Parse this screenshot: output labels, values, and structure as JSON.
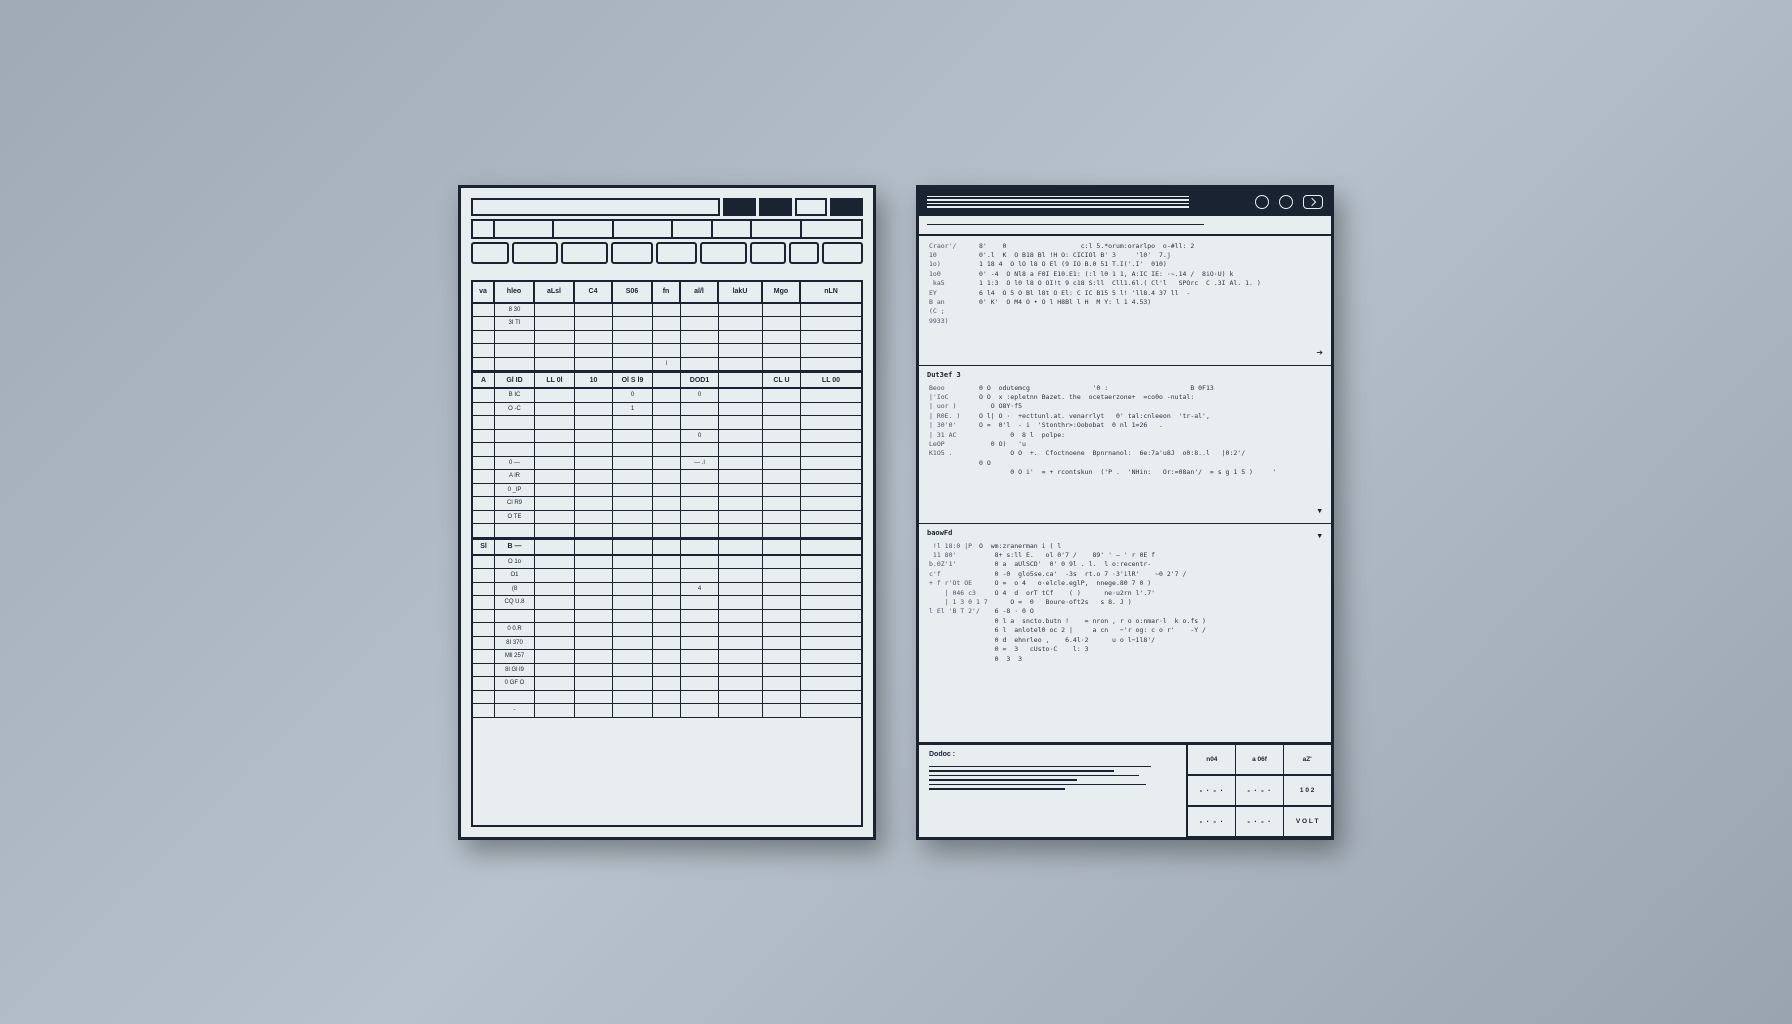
{
  "left": {
    "toolbar_row2_widths": [
      22,
      60,
      60,
      60,
      40,
      40,
      50,
      60
    ],
    "toolbar_row3_widths": [
      40,
      50,
      50,
      44,
      44,
      50,
      38,
      32,
      44
    ],
    "headers1": [
      "va",
      "hleo",
      "aLsl",
      "C4",
      "S06",
      "fn",
      "al/l",
      "lakU",
      "Mgo",
      "nLN"
    ],
    "rows1": [
      [
        "",
        "8 30",
        "",
        "",
        "",
        "",
        "",
        "",
        "",
        ""
      ],
      [
        "",
        "3I TI",
        "",
        "",
        "",
        "",
        "",
        "",
        "",
        ""
      ],
      [
        "",
        "",
        "",
        "",
        "",
        "",
        "",
        "",
        "",
        ""
      ],
      [
        "",
        "",
        "",
        "",
        "",
        "",
        "",
        "",
        "",
        ""
      ],
      [
        "",
        "",
        "",
        "",
        "",
        "l",
        "",
        "",
        "",
        ""
      ]
    ],
    "headers2": [
      "A",
      "Gl ID",
      "LL 0l",
      "10",
      "Ol S l9",
      "",
      "DOD1",
      "",
      "CL U",
      "LL 00"
    ],
    "rows2": [
      [
        "",
        "B IC",
        "",
        "",
        "0",
        "",
        "0",
        "",
        "",
        ""
      ],
      [
        "",
        "O -C",
        "",
        "",
        "1",
        "",
        "",
        "",
        "",
        ""
      ],
      [
        "",
        "",
        "",
        "",
        "",
        "",
        "",
        "",
        "",
        ""
      ],
      [
        "",
        "",
        "",
        "",
        "",
        "",
        "0",
        "",
        "",
        ""
      ],
      [
        "",
        "",
        "",
        "",
        "",
        "",
        "",
        "",
        "",
        ""
      ],
      [
        "",
        "0 —",
        "",
        "",
        "",
        "",
        "— .l",
        "",
        "",
        ""
      ],
      [
        "",
        "A lR",
        "",
        "",
        "",
        "",
        "",
        "",
        "",
        ""
      ],
      [
        "",
        "0 _lP",
        "",
        "",
        "",
        "",
        "",
        "",
        "",
        ""
      ],
      [
        "",
        "Cl R9",
        "",
        "",
        "",
        "",
        "",
        "",
        "",
        ""
      ],
      [
        "",
        "O TE",
        "",
        "",
        "",
        "",
        "",
        "",
        "",
        ""
      ],
      [
        "",
        "",
        "",
        "",
        "",
        "",
        "",
        "",
        "",
        ""
      ]
    ],
    "headers3": [
      "Sl",
      "B —",
      "",
      "",
      "",
      "",
      "",
      "",
      "",
      ""
    ],
    "rows3": [
      [
        "",
        "O 1o",
        "",
        "",
        "",
        "",
        "",
        "",
        "",
        ""
      ],
      [
        "",
        "O1",
        "",
        "",
        "",
        "",
        "",
        "",
        "",
        ""
      ],
      [
        "",
        "(8",
        "",
        "",
        "",
        "",
        "4",
        "",
        "",
        ""
      ],
      [
        "",
        "CQ U.8",
        "",
        "",
        "",
        "",
        "",
        "",
        "",
        ""
      ],
      [
        "",
        "",
        "",
        "",
        "",
        "",
        "",
        "",
        "",
        ""
      ],
      [
        "",
        "0 0.R",
        "",
        "",
        "",
        "",
        "",
        "",
        "",
        ""
      ],
      [
        "",
        "8I 370",
        "",
        "",
        "",
        "",
        "",
        "",
        "",
        ""
      ],
      [
        "",
        "Mll 257",
        "",
        "",
        "",
        "",
        "",
        "",
        "",
        ""
      ],
      [
        "",
        "8l Gl l9",
        "",
        "",
        "",
        "",
        "",
        "",
        "",
        ""
      ],
      [
        "",
        "0 GF O",
        "",
        "",
        "",
        "",
        "",
        "",
        "",
        ""
      ],
      [
        "",
        "",
        "",
        "",
        "",
        "",
        "",
        "",
        "",
        ""
      ],
      [
        "",
        "-",
        "",
        "",
        "",
        "",
        "",
        "",
        "",
        ""
      ]
    ]
  },
  "right": {
    "pane1": {
      "gutter": "Craor'/\n10\n1o)\n1o0\n ka5\nEY\nB an\n(C ;\n9933)",
      "code": "8'    0                   c:l 5.*orum:orarlpo  o-#ll: 2\n0'.l  K  O B18 Bl !H O: CICIOl B' 3     'l0'  7.j\n1 18 4  O lO l8 O El (9 IO B.0 51 T.I('.I'  010)\n0' -4  O Nl8 a F0I E10.E1: (:l l0 1 1, A:IC IE: ·~.14 /  8iO·U) k\n1 1:3  O l0 l8 O OI!t 9 c18 S:ll  Cll1.6l.( Cl'l   SPOrc  C .3I Al. 1. )\n6 l4  O 5 O Bl l8t O El: C IC B15 5 l! 'll8.4 37 ll  -\n0' K'  O M4 O • O l H8Bl l H  M Y: l 1 4.53)"
    },
    "pane2": {
      "title": "Dut3ef 3",
      "gutter": "Beoo\n|'IoC\n| uor )\n| R0E. )\n| 30'0'\n| 31 AC\nLeOP\nK1O5 .",
      "code": "0 O  odutemcg                '0 :                     B 0F13\nO O  x :epletnn Bazet. the  ocetaerzone+  =co0o -nutal:\n   O O8Y·f5\nO l| O ·  +ecttunl.at. venarrlyt   0' tal:cnleeon  'tr-al',\nO =  0'l  - i  'Stonthr>:Oobobat  0 nl 1=26   .\n        0  8 l  polpe:\n   0 O)   'u\n        O O  +.  Cfoctnoene  Bpnrnanol:  6e:7a'u8J  o0:8..l   |0:2'/\n0 O\n        0 O i'  = + rcontskun  ('P .  'NHin:   Or:=08an'/  = s g 1 5 )     '"
    },
    "pane3": {
      "title": "baowFd",
      "gutter": " !l 18:0 |P\n 11 80'\nb.0Z'1'\nc'f\n+ f r'Ot OE\n    | 046 c3\n    | 1 3 0 1 7\nl El 'B T 2'/",
      "code": "O  wm:zranerman i ( l\n    8+ s:ll E.   ol 0'7 /    89' ' – ' r 0E f\n    0 a  aUlSCD'  0' 0 9l . l.  l o:recentr-\n    0 -0  glo5se.ca'  -3s  rt.o 7 ·3'ilR'    ~0 2'7 /\n    O =  o 4   o·elcle.eglP,  nnege.80 7 0 )\n    O 4  d  orT tCf    ( )      ne·u2rn l'.7'\n        O =  0   Boure·oft2s   s 8. J )\n    6 -8 · 0 O\n    0 l a  sncto.butn !    = nron , r o o:nmar·l  k o.fs )\n    6 l  anlotel0 oc 2 |     a cn   −'r og: c o r'    -Y /\n    0 d  ehnrleo ,    6.4l·2      u o l−1l8'/\n    0 =  3   cUsto·C    l: 3\n    0  3  3"
    },
    "footer": {
      "label": "Dodoc :",
      "grid": [
        "n04",
        "a 06f",
        "aZ'",
        "",
        "",
        "1 0 2",
        "",
        "",
        "V O L T"
      ]
    }
  }
}
